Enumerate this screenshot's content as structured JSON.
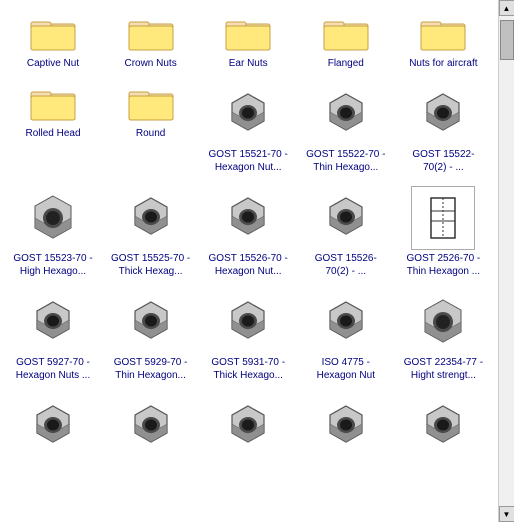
{
  "items": [
    {
      "type": "folder",
      "label": "Captive Nut"
    },
    {
      "type": "folder",
      "label": "Crown Nuts"
    },
    {
      "type": "folder",
      "label": "Ear Nuts"
    },
    {
      "type": "folder",
      "label": "Flanged"
    },
    {
      "type": "folder",
      "label": "Nuts for aircraft"
    },
    {
      "type": "folder",
      "label": "Rolled Head"
    },
    {
      "type": "folder",
      "label": "Round"
    },
    {
      "type": "nut_hex",
      "label": "GOST 15521-70 - Hexagon Nut..."
    },
    {
      "type": "nut_hex_thin",
      "label": "GOST 15522-70 - Thin Hexago..."
    },
    {
      "type": "nut_round",
      "label": "GOST 15522-70(2) - ..."
    },
    {
      "type": "nut_high",
      "label": "GOST 15523-70 - High Hexago..."
    },
    {
      "type": "nut_thick",
      "label": "GOST 15525-70 - Thick Hexag..."
    },
    {
      "type": "nut_hex2",
      "label": "GOST 15526-70 - Hexagon Nut..."
    },
    {
      "type": "nut_hex2b",
      "label": "GOST 15526-70(2) - ..."
    },
    {
      "type": "nut_diagram",
      "label": "GOST 2526-70 - Thin Hexagon ..."
    },
    {
      "type": "nut_small",
      "label": "GOST 5927-70 - Hexagon Nuts ..."
    },
    {
      "type": "nut_thin2",
      "label": "GOST 5929-70 - Thin Hexagon..."
    },
    {
      "type": "nut_thick2",
      "label": "GOST 5931-70 - Thick Hexago..."
    },
    {
      "type": "nut_iso",
      "label": "ISO 4775 - Hexagon Nut"
    },
    {
      "type": "nut_high2",
      "label": "GOST 22354-77 - Hight strengt..."
    },
    {
      "type": "nut_small2",
      "label": ""
    },
    {
      "type": "nut_cap",
      "label": ""
    },
    {
      "type": "nut_sq",
      "label": ""
    },
    {
      "type": "nut_wide",
      "label": ""
    },
    {
      "type": "nut_flange",
      "label": ""
    }
  ]
}
